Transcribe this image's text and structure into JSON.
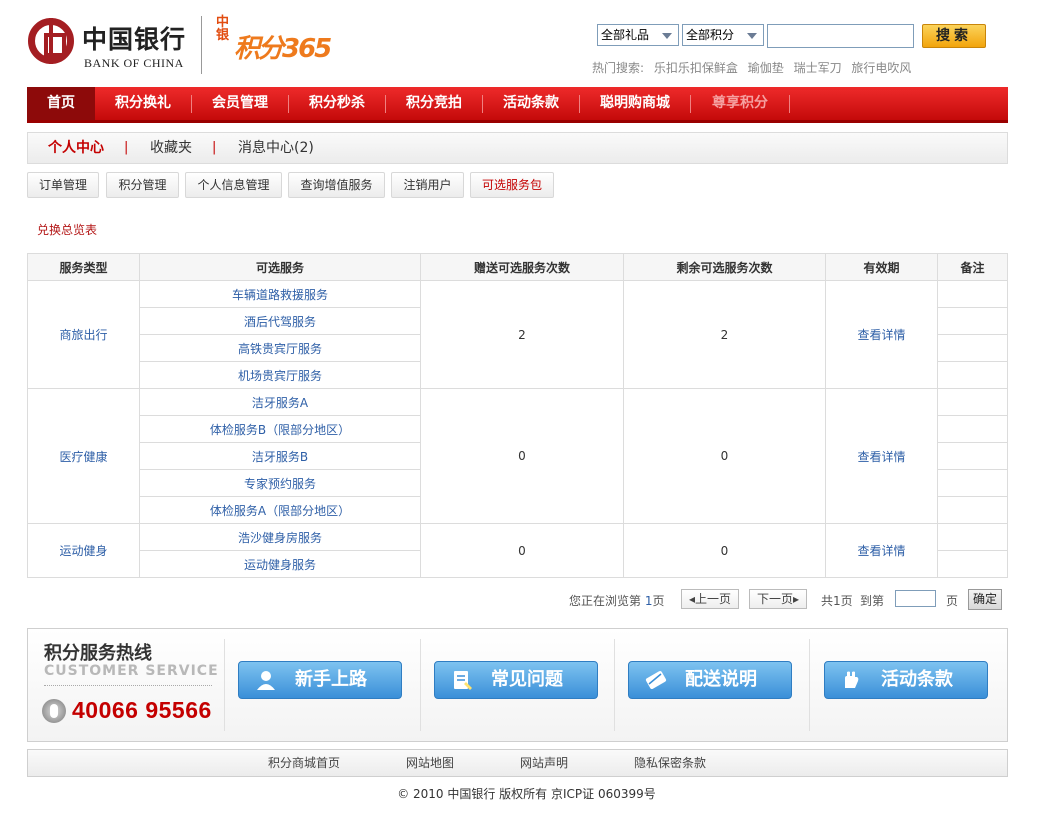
{
  "header": {
    "logo_cn": "中国银行",
    "logo_en": "BANK OF CHINA",
    "brand_side": "中银",
    "brand_main": "积分365",
    "select_gift": "全部礼品",
    "select_points": "全部积分",
    "search_value": "",
    "search_button": "搜索",
    "hot_label": "热门搜索:",
    "hot_items": [
      "乐扣乐扣保鲜盒",
      "瑜伽垫",
      "瑞士军刀",
      "旅行电吹风"
    ]
  },
  "mainnav": {
    "items": [
      "首页",
      "积分换礼",
      "会员管理",
      "积分秒杀",
      "积分竞拍",
      "活动条款",
      "聪明购商城",
      "尊享积分"
    ]
  },
  "subnav": {
    "items": [
      "个人中心",
      "收藏夹",
      "消息中心(2)"
    ],
    "separator": "|"
  },
  "tabs": [
    "订单管理",
    "积分管理",
    "个人信息管理",
    "查询增值服务",
    "注销用户",
    "可选服务包"
  ],
  "overview_link": "兑换总览表",
  "table": {
    "headers": [
      "服务类型",
      "可选服务",
      "赠送可选服务次数",
      "剩余可选服务次数",
      "有效期",
      "备注"
    ],
    "groups": [
      {
        "category": "商旅出行",
        "services": [
          "车辆道路救援服务",
          "酒后代驾服务",
          "高铁贵宾厅服务",
          "机场贵宾厅服务"
        ],
        "given": "2",
        "remaining": "2",
        "validity": "查看详情"
      },
      {
        "category": "医疗健康",
        "services": [
          "洁牙服务A",
          "体检服务B（限部分地区）",
          "洁牙服务B",
          "专家预约服务",
          "体检服务A（限部分地区）"
        ],
        "given": "0",
        "remaining": "0",
        "validity": "查看详情"
      },
      {
        "category": "运动健身",
        "services": [
          "浩沙健身房服务",
          "运动健身服务"
        ],
        "given": "0",
        "remaining": "0",
        "validity": "查看详情"
      }
    ]
  },
  "pager": {
    "browsing_prefix": "您正在浏览第",
    "current_page": "1",
    "page_suffix": "页",
    "prev": "上一页",
    "next": "下一页",
    "total_prefix": "共",
    "total_pages": "1",
    "total_suffix": "页",
    "goto_label": "到第",
    "goto_suffix": "页",
    "ok_button": "确定"
  },
  "service": {
    "hotline_title": "积分服务热线",
    "hotline_en": "CUSTOMER SERVICE",
    "phone": "40066  95566",
    "buttons": [
      "新手上路",
      "常见问题",
      "配送说明",
      "活动条款"
    ]
  },
  "footer": {
    "links": [
      "积分商城首页",
      "网站地图",
      "网站声明",
      "隐私保密条款"
    ],
    "copyright": "© 2010 中国银行  版权所有  京ICP证  060399号"
  },
  "colors": {
    "brand_red": "#c40000",
    "nav_red": "#e01515",
    "link_blue": "#2e5fa7",
    "button_blue": "#3a8fd8",
    "search_orange": "#f2a40c"
  }
}
